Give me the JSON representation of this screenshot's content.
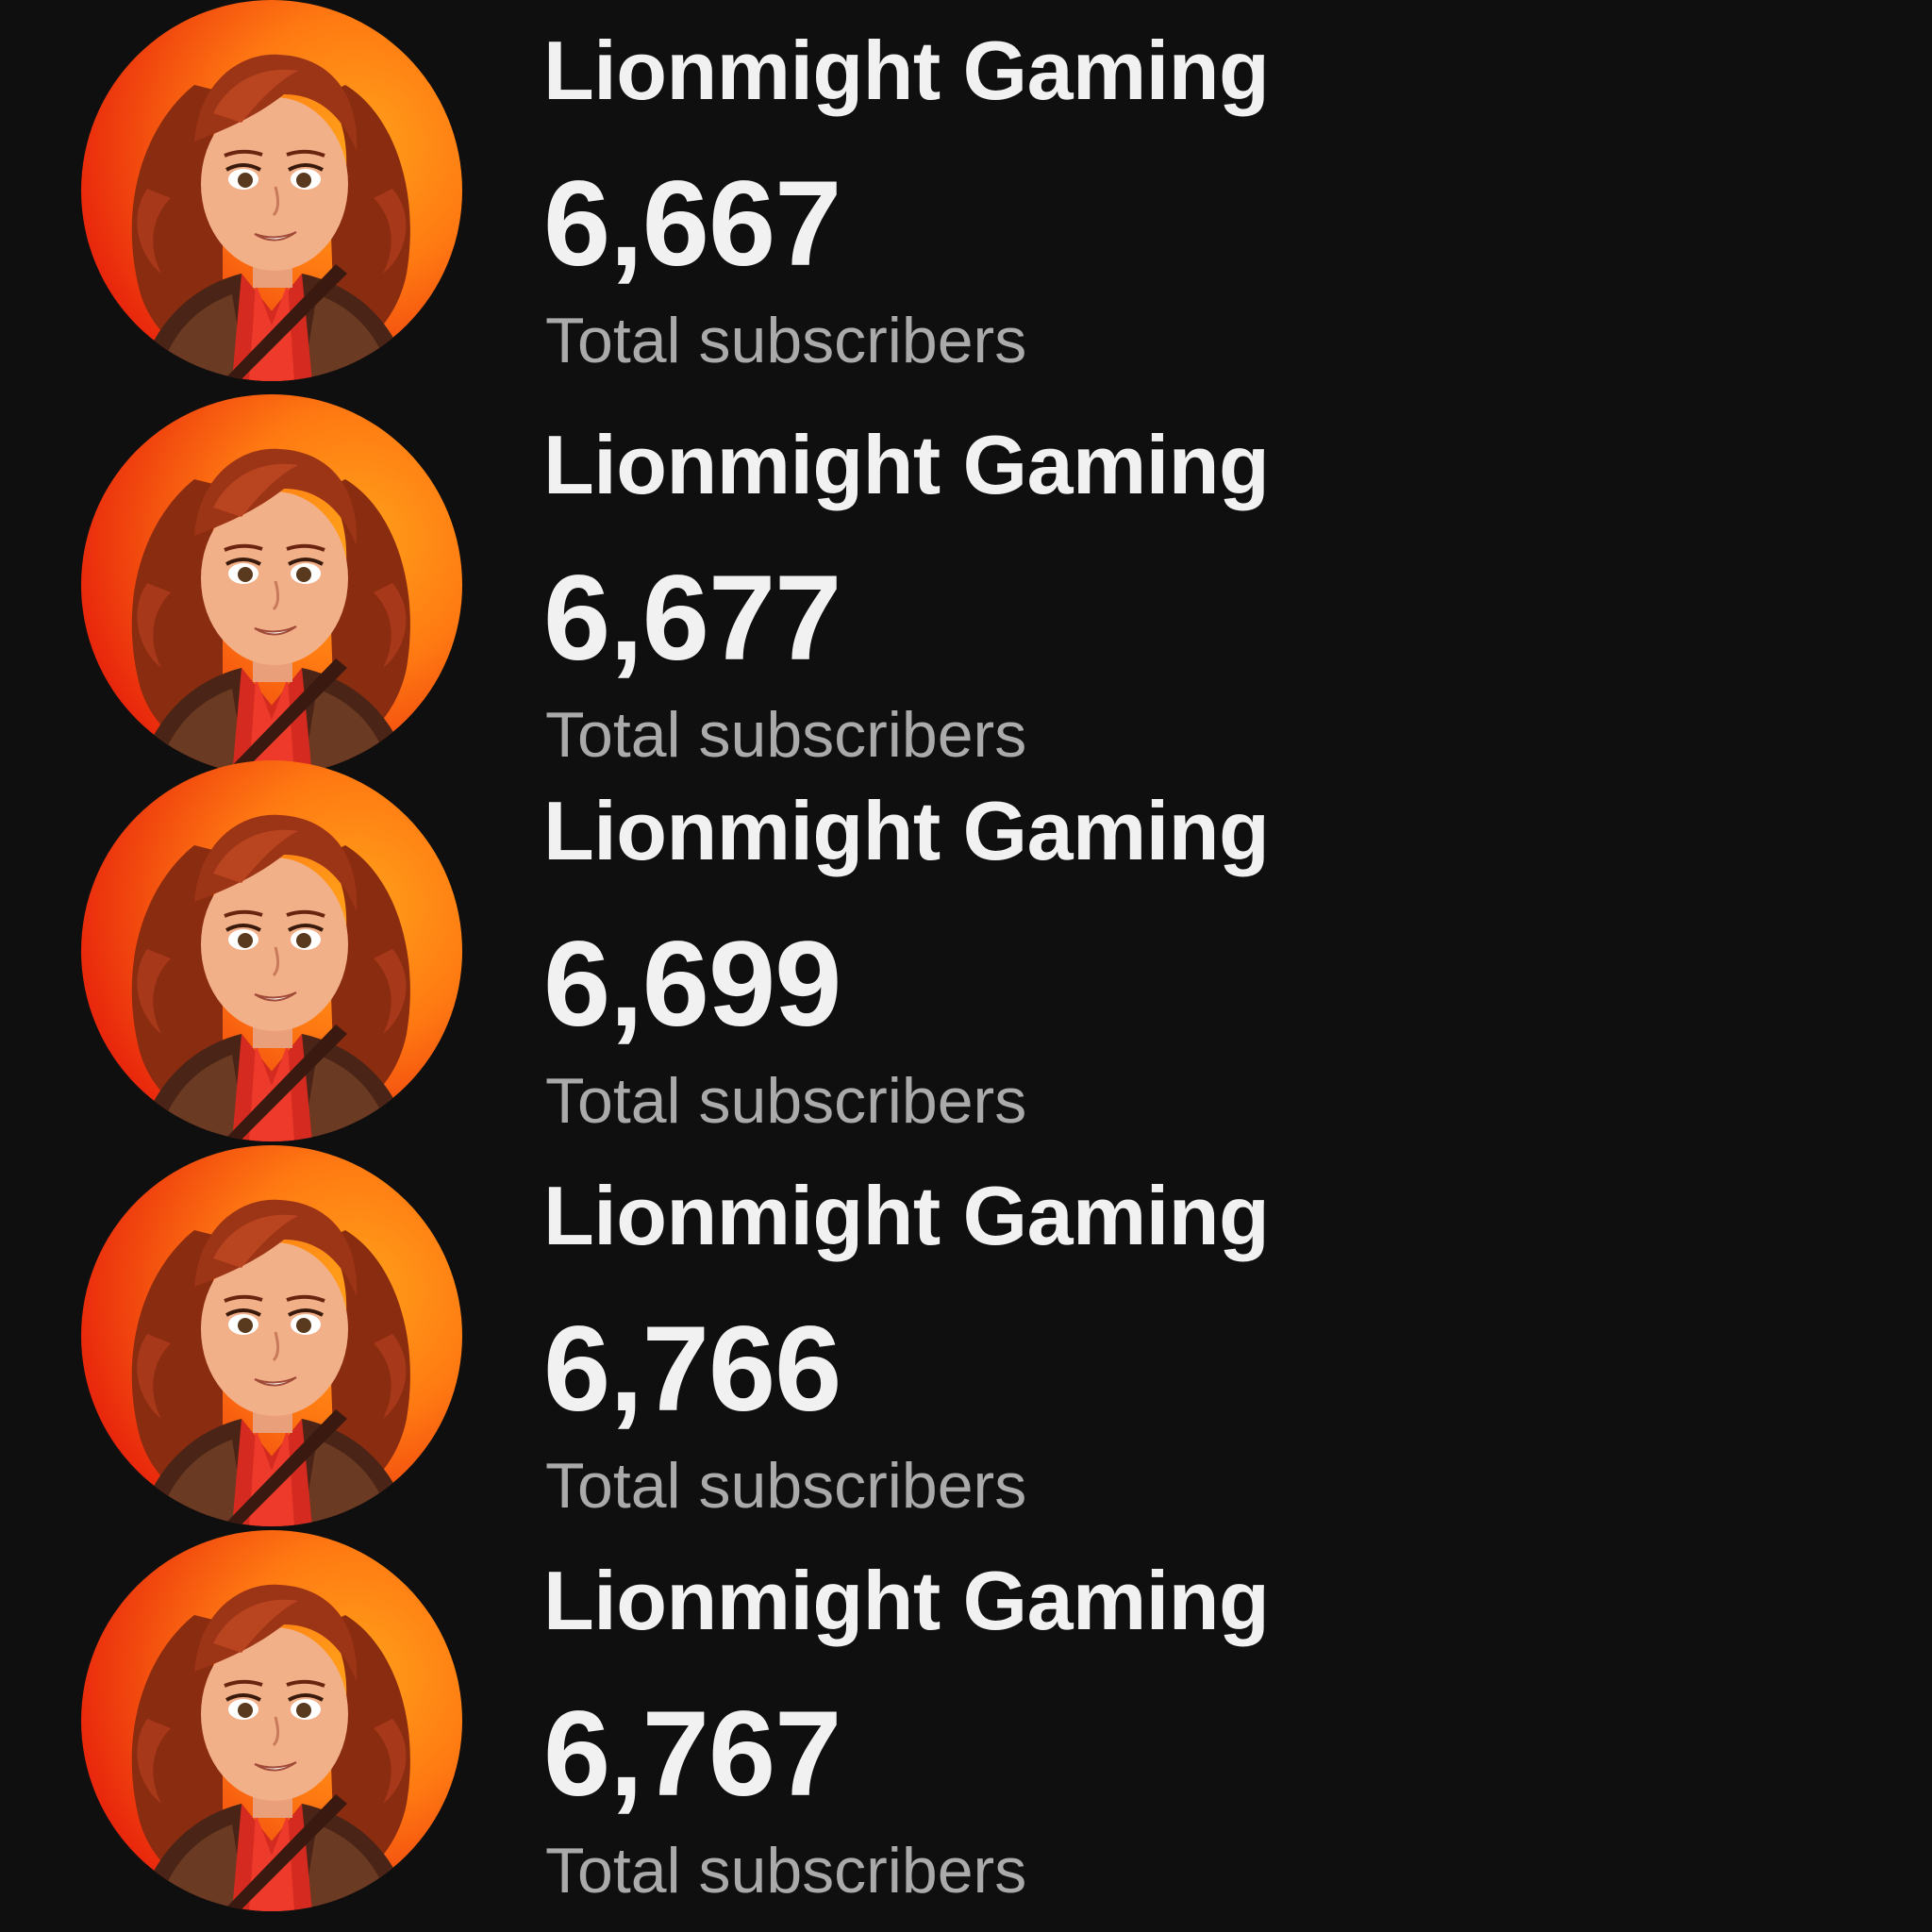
{
  "colors": {
    "background": "#0f0f0f",
    "primary_text": "#f1f1f1",
    "secondary_text": "#aaaaaa",
    "avatar_orange": "#ff7a12"
  },
  "cards": [
    {
      "channel_name": "Lionmight Gaming",
      "subscriber_count": "6,667",
      "subscriber_label": "Total subscribers",
      "avatar": "channel-avatar-icon"
    },
    {
      "channel_name": "Lionmight Gaming",
      "subscriber_count": "6,677",
      "subscriber_label": "Total subscribers",
      "avatar": "channel-avatar-icon"
    },
    {
      "channel_name": "Lionmight Gaming",
      "subscriber_count": "6,699",
      "subscriber_label": "Total subscribers",
      "avatar": "channel-avatar-icon"
    },
    {
      "channel_name": "Lionmight Gaming",
      "subscriber_count": "6,766",
      "subscriber_label": "Total subscribers",
      "avatar": "channel-avatar-icon"
    },
    {
      "channel_name": "Lionmight Gaming",
      "subscriber_count": "6,767",
      "subscriber_label": "Total subscribers",
      "avatar": "channel-avatar-icon"
    }
  ]
}
